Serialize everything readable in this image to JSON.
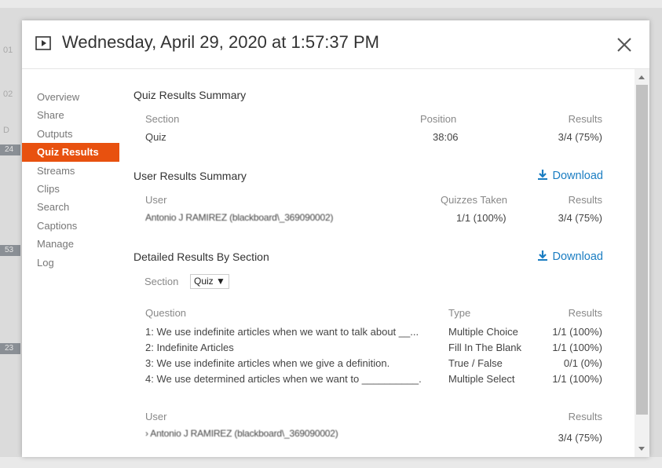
{
  "background": {
    "numbers": [
      "01",
      "02",
      "D",
      "24",
      "53",
      "23"
    ]
  },
  "header": {
    "title": "Wednesday, April 29, 2020 at 1:57:37 PM"
  },
  "sidebar": {
    "items": [
      {
        "label": "Overview"
      },
      {
        "label": "Share"
      },
      {
        "label": "Outputs"
      },
      {
        "label": "Quiz Results"
      },
      {
        "label": "Streams"
      },
      {
        "label": "Clips"
      },
      {
        "label": "Search"
      },
      {
        "label": "Captions"
      },
      {
        "label": "Manage"
      },
      {
        "label": "Log"
      }
    ],
    "active": "Quiz Results",
    "accent": "#e8510f"
  },
  "quiz_summary": {
    "heading": "Quiz Results Summary",
    "columns": {
      "section": "Section",
      "position": "Position",
      "results": "Results"
    },
    "row": {
      "section": "Quiz",
      "position": "38:06",
      "results": "3/4 (75%)"
    }
  },
  "user_summary": {
    "heading": "User Results Summary",
    "download": "Download",
    "columns": {
      "user": "User",
      "quizzes": "Quizzes Taken",
      "results": "Results"
    },
    "row": {
      "user": "Antonio J RAMIREZ (blackboard\\_369090002)",
      "quizzes": "1/1 (100%)",
      "results": "3/4 (75%)"
    }
  },
  "detailed": {
    "heading": "Detailed Results By Section",
    "download": "Download",
    "section_label": "Section",
    "section_value": "Quiz ▼",
    "columns": {
      "question": "Question",
      "type": "Type",
      "results": "Results"
    },
    "rows": [
      {
        "question": "1: We use indefinite articles when we want to talk about __...",
        "type": "Multiple Choice",
        "results": "1/1 (100%)"
      },
      {
        "question": "2: Indefinite Articles",
        "type": "Fill In The Blank",
        "results": "1/1 (100%)"
      },
      {
        "question": "3: We use indefinite articles when we give a definition.",
        "type": "True / False",
        "results": "0/1 (0%)"
      },
      {
        "question": "4: We use determined articles when we want to __________.",
        "type": "Multiple Select",
        "results": "1/1 (100%)"
      }
    ],
    "user_columns": {
      "user": "User",
      "results": "Results"
    },
    "user_row": {
      "user": "› Antonio J RAMIREZ (blackboard\\_369090002)",
      "results": "3/4 (75%)"
    }
  },
  "colors": {
    "link": "#1a7dc2",
    "accent": "#e8510f"
  }
}
